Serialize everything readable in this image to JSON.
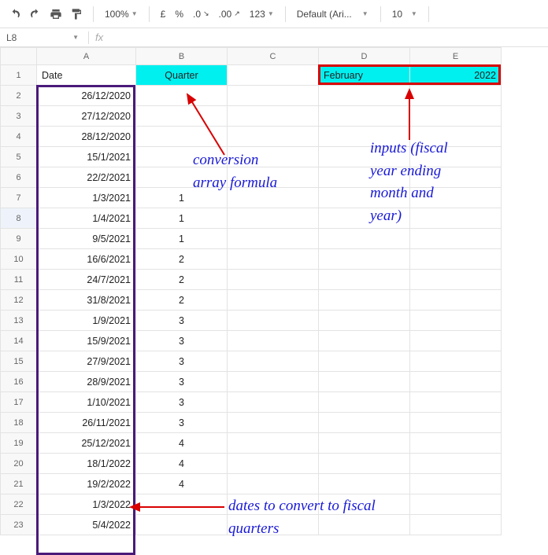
{
  "toolbar": {
    "zoom": "100%",
    "currency": "£",
    "percent": "%",
    "dec_dec": ".0",
    "dec_inc": ".00",
    "numfmt": "123",
    "font": "Default (Ari...",
    "fontsize": "10"
  },
  "namebox": {
    "ref": "L8",
    "fx": "fx"
  },
  "cols": [
    "A",
    "B",
    "C",
    "D",
    "E"
  ],
  "rows": [
    "1",
    "2",
    "3",
    "4",
    "5",
    "6",
    "7",
    "8",
    "9",
    "10",
    "11",
    "12",
    "13",
    "14",
    "15",
    "16",
    "17",
    "18",
    "19",
    "20",
    "21",
    "22",
    "23"
  ],
  "cells": {
    "A1": "Date",
    "B1": "Quarter",
    "D1": "February",
    "E1": "2022",
    "A2": "26/12/2020",
    "A3": "27/12/2020",
    "A4": "28/12/2020",
    "A5": "15/1/2021",
    "A6": "22/2/2021",
    "A7": "1/3/2021",
    "B7": "1",
    "A8": "1/4/2021",
    "B8": "1",
    "A9": "9/5/2021",
    "B9": "1",
    "A10": "16/6/2021",
    "B10": "2",
    "A11": "24/7/2021",
    "B11": "2",
    "A12": "31/8/2021",
    "B12": "2",
    "A13": "1/9/2021",
    "B13": "3",
    "A14": "15/9/2021",
    "B14": "3",
    "A15": "27/9/2021",
    "B15": "3",
    "A16": "28/9/2021",
    "B16": "3",
    "A17": "1/10/2021",
    "B17": "3",
    "A18": "26/11/2021",
    "B18": "3",
    "A19": "25/12/2021",
    "B19": "4",
    "A20": "18/1/2022",
    "B20": "4",
    "A21": "19/2/2022",
    "B21": "4",
    "A22": "1/3/2022",
    "A23": "5/4/2022"
  },
  "annotations": {
    "formula": "conversion\narray formula",
    "inputs": "inputs (fiscal\nyear ending\nmonth and\nyear)",
    "dates": "dates to convert to fiscal\nquarters"
  }
}
